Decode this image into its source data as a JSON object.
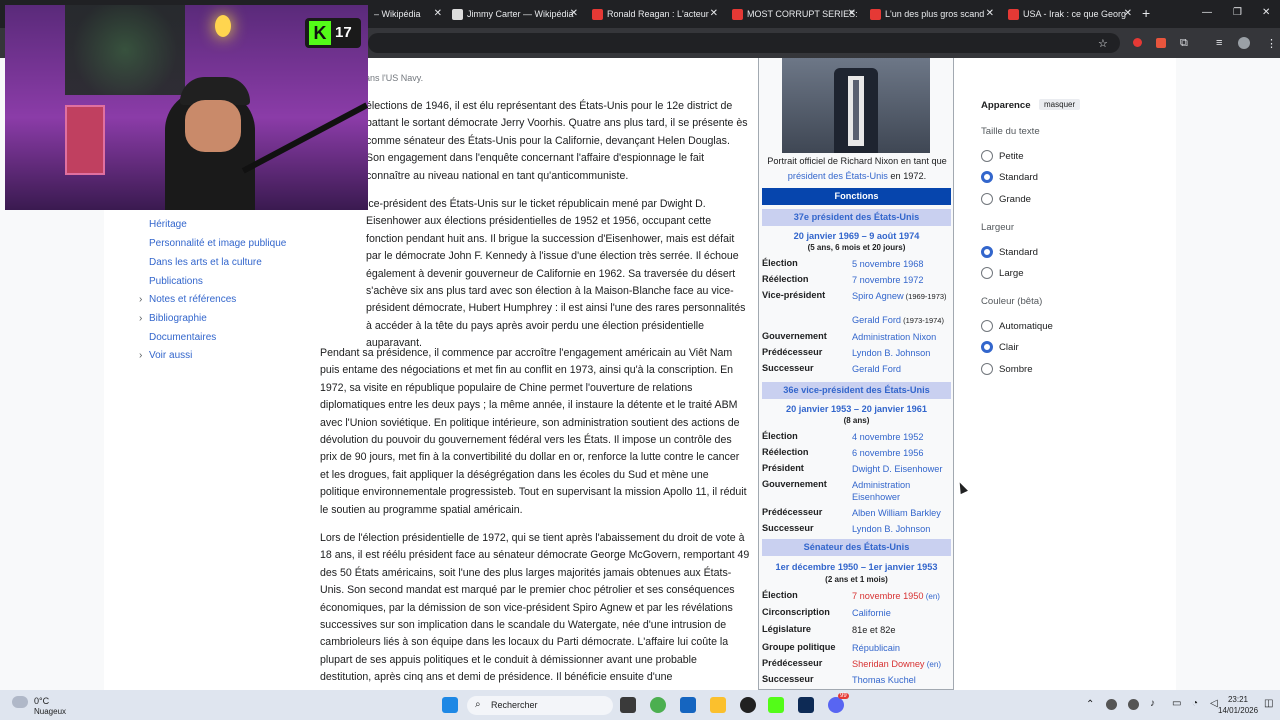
{
  "browser": {
    "tabs": [
      {
        "label": "– Wikipédia",
        "fav": "#999"
      },
      {
        "label": "Jimmy Carter — Wikipédia",
        "fav": "#ddd"
      },
      {
        "label": "Ronald Reagan : L'acteur",
        "fav": "#e53935"
      },
      {
        "label": "MOST CORRUPT SERIES:",
        "fav": "#e53935"
      },
      {
        "label": "L'un des plus gros scand",
        "fav": "#e53935"
      },
      {
        "label": "USA - Irak : ce que Georg",
        "fav": "#e53935"
      }
    ],
    "new_tab": "+",
    "minimize": "—",
    "maximize": "❐",
    "close": "✕",
    "tab_close": "✕"
  },
  "toc": [
    {
      "label": "Héritage",
      "chevron": false
    },
    {
      "label": "Personnalité et image publique",
      "chevron": false
    },
    {
      "label": "Dans les arts et la culture",
      "chevron": false
    },
    {
      "label": "Publications",
      "chevron": false
    },
    {
      "label": "Notes et références",
      "chevron": true
    },
    {
      "label": "Bibliographie",
      "chevron": true
    },
    {
      "label": "Documentaires",
      "chevron": false
    },
    {
      "label": "Voir aussi",
      "chevron": true
    }
  ],
  "article": {
    "p0": "dans l'US Navy.",
    "p1": "élections de 1946, il est élu représentant des États-Unis pour le 12e district de  battant le sortant démocrate Jerry Voorhis. Quatre ans plus tard, il se présente ès comme sénateur des États-Unis pour la Californie, devançant Helen Douglas. Son engagement dans l'enquête concernant l'affaire d'espionnage le fait connaître au niveau national en tant qu'anticommuniste.",
    "p2": "ice-président des États-Unis sur le ticket républicain mené par Dwight D. Eisenhower aux élections présidentielles de 1952 et 1956, occupant cette fonction pendant huit ans. Il brigue la succession d'Eisenhower, mais est défait par le démocrate John F. Kennedy à l'issue d'une élection très serrée. Il échoue également à devenir gouverneur de Californie en 1962. Sa traversée du désert s'achève six ans plus tard avec son élection à la Maison-Blanche face au vice-président démocrate, Hubert Humphrey : il est ainsi l'une des rares personnalités à accéder à la tête du pays après avoir perdu une élection présidentielle auparavant.",
    "p3": "Pendant sa présidence, il commence par accroître l'engagement américain au Viêt Nam puis entame des négociations et met fin au conflit en 1973, ainsi qu'à la conscription. En 1972, sa visite en république populaire de Chine permet l'ouverture de relations diplomatiques entre les deux pays ; la même année, il instaure la détente et le traité ABM avec l'Union soviétique. En politique intérieure, son administration soutient des actions de dévolution du pouvoir du gouvernement fédéral vers les États. Il impose un contrôle des prix de 90 jours, met fin à la convertibilité du dollar en or, renforce la lutte contre le cancer et les drogues, fait appliquer la déségrégation dans les écoles du Sud et mène une politique environnementale progressisteb. Tout en supervisant la mission Apollo 11, il réduit le soutien au programme spatial américain.",
    "p4": "Lors de l'élection présidentielle de 1972, qui se tient après l'abaissement du droit de vote à 18 ans, il est réélu président face au sénateur démocrate George McGovern, remportant 49 des 50 États américains, soit l'une des plus larges majorités jamais obtenues aux États-Unis. Son second mandat est marqué par le premier choc pétrolier et ses conséquences économiques, par la démission de son vice-président Spiro Agnew et par les révélations successives sur son implication dans le scandale du Watergate, née d'une intrusion de cambrioleurs liés à son équipe dans les locaux du Parti démocrate. L'affaire lui coûte la plupart de ses appuis politiques et le conduit à démissionner avant une probable destitution, après cinq ans et demi de présidence. Il bénéficie ensuite d'une"
  },
  "infobox": {
    "caption_a": "Portrait officiel de Richard Nixon en tant que ",
    "caption_link": "président des États-Unis",
    "caption_b": " en 1972.",
    "fonctions": "Fonctions",
    "sec1_title": "37e président des États-Unis",
    "sec1_dates": "20 janvier 1969 – 9 août 1974",
    "sec1_dur": "(5 ans, 6 mois et 20 jours)",
    "sec1_rows": [
      {
        "label": "Élection",
        "value": "5 novembre 1968"
      },
      {
        "label": "Réélection",
        "value": "7 novembre 1972"
      },
      {
        "label": "Vice-président",
        "value": "Spiro Agnew",
        "note": "(1969-1973)"
      },
      {
        "label": "",
        "value": "Gerald Ford",
        "note": "(1973-1974)"
      },
      {
        "label": "Gouvernement",
        "value": "Administration Nixon"
      },
      {
        "label": "Prédécesseur",
        "value": "Lyndon B. Johnson"
      },
      {
        "label": "Successeur",
        "value": "Gerald Ford"
      }
    ],
    "sec2_title": "36e vice-président des États-Unis",
    "sec2_dates": "20 janvier 1953 – 20 janvier 1961",
    "sec2_dur": "(8 ans)",
    "sec2_rows": [
      {
        "label": "Élection",
        "value": "4 novembre 1952"
      },
      {
        "label": "Réélection",
        "value": "6 novembre 1956"
      },
      {
        "label": "Président",
        "value": "Dwight D. Eisenhower"
      },
      {
        "label": "Gouvernement",
        "value": "Administration Eisenhower"
      },
      {
        "label": "Prédécesseur",
        "value": "Alben William Barkley"
      },
      {
        "label": "Successeur",
        "value": "Lyndon B. Johnson"
      }
    ],
    "sec3_title": "Sénateur des États-Unis",
    "sec3_dates": "1er décembre 1950 – 1er janvier 1953",
    "sec3_dur": "(2 ans et 1 mois)",
    "sec3_rows": [
      {
        "label": "Élection",
        "value": "7 novembre 1950",
        "en": "(en)",
        "red": true
      },
      {
        "label": "Circonscription",
        "value": "Californie"
      },
      {
        "label": "Législature",
        "value": "81e et 82e",
        "plain": true
      },
      {
        "label": "Groupe politique",
        "value": "Républicain"
      },
      {
        "label": "Prédécesseur",
        "value": "Sheridan Downey",
        "en": "(en)",
        "red": true
      },
      {
        "label": "Successeur",
        "value": "Thomas Kuchel"
      }
    ]
  },
  "appearance": {
    "title": "Apparence",
    "hide": "masquer",
    "text_size": "Taille du texte",
    "small": "Petite",
    "standard": "Standard",
    "large": "Grande",
    "width": "Largeur",
    "width_standard": "Standard",
    "width_large": "Large",
    "color": "Couleur (bêta)",
    "auto": "Automatique",
    "light": "Clair",
    "dark": "Sombre"
  },
  "overlay": {
    "badge_letter": "K",
    "badge_count": "17"
  },
  "taskbar": {
    "temp": "0°C",
    "weather": "Nuageux",
    "search": "Rechercher",
    "time": "23:21",
    "date": "14/01/2026",
    "notif": "99"
  }
}
